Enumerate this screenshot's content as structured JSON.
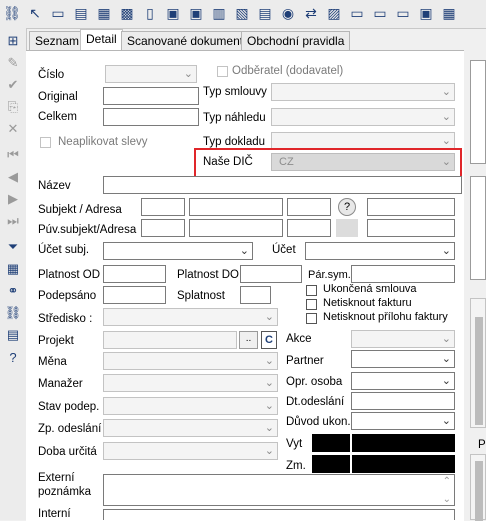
{
  "toolbar": {
    "icons": [
      "org-icon",
      "arrow-icon",
      "monitor-icon",
      "printer-icon",
      "grid-icon",
      "document-icon",
      "floppy-icon",
      "floppy2-icon",
      "document-arrow-icon",
      "document-edit-icon",
      "disc-icon",
      "swap-icon",
      "image-icon",
      "card-icon",
      "card2-icon",
      "floppy3-icon",
      "grid2-icon"
    ]
  },
  "sidebar": {
    "icons": [
      "add-icon",
      "edit-icon",
      "check-icon",
      "copy-icon",
      "delete-icon",
      "first-icon",
      "prev-icon",
      "next-icon",
      "last-icon",
      "filter-icon",
      "table-icon",
      "link-icon",
      "org-tree-icon",
      "list-icon",
      "help-icon"
    ]
  },
  "tabs": [
    "Seznam",
    "Detail",
    "Scanované dokumenty",
    "Obchodní pravidla"
  ],
  "form": {
    "cislo": "Číslo",
    "odberatel": "Odběratel (dodavatel)",
    "original": "Original",
    "typ_smlouvy": "Typ smlouvy",
    "celkem": "Celkem",
    "typ_nahledu": "Typ náhledu",
    "neaplikovat": "Neaplikovat slevy",
    "typ_dokladu": "Typ dokladu",
    "nase_dic": "Naše DIČ",
    "nase_dic_value": "CZ",
    "nazev": "Název",
    "subjekt_adresa": "Subjekt / Adresa",
    "puv_subjekt": "Púv.subjekt/Adresa",
    "ucet_subj": "Účet subj.",
    "ucet": "Účet",
    "platnost_od": "Platnost OD",
    "platnost_do": "Platnost DO",
    "par_sym": "Pár.sym.",
    "podepsano": "Podepsáno",
    "splatnost": "Splatnost",
    "ukoncena": "Ukončená smlouva",
    "netisknout_fakturu": "Netisknout fakturu",
    "netisknout_prilohu": "Netisknout přílohu faktury",
    "stredisko": "Středisko  :",
    "projekt": "Projekt",
    "akce": "Akce",
    "mena": "Měna",
    "partner": "Partner",
    "manazer": "Manažer",
    "opr_osoba": "Opr. osoba",
    "stav_podep": "Stav podep.",
    "dt_odeslani": "Dt.odeslání",
    "zp_odeslani": "Zp. odeslání",
    "duvod_ukon": "Důvod ukon.",
    "doba_urcita": "Doba určitá",
    "vyt": "Vyt",
    "zm": "Zm.",
    "externi": "Externí",
    "poznamka": "poznámka",
    "interni": "Interní",
    "ellipsis": "..",
    "c_button": "C",
    "help_button": "?",
    "right_label_p": "P"
  }
}
